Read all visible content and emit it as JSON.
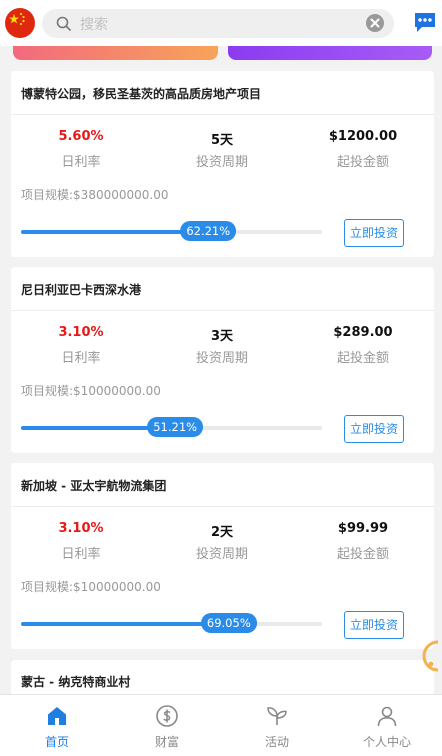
{
  "header": {
    "search_placeholder": "搜索"
  },
  "projects": [
    {
      "title": "博蒙特公园，移民圣基茨的高品质房地产项目",
      "rate": "5.60%",
      "rate_label": "日利率",
      "period": "5天",
      "period_label": "投资周期",
      "min": "$1200.00",
      "min_label": "起投金额",
      "scale": "项目规模:$380000000.00",
      "progress_text": "62.21%",
      "progress": 0.6221,
      "button": "立即投资"
    },
    {
      "title": "尼日利亚巴卡西深水港",
      "rate": "3.10%",
      "rate_label": "日利率",
      "period": "3天",
      "period_label": "投资周期",
      "min": "$289.00",
      "min_label": "起投金额",
      "scale": "项目规模:$10000000.00",
      "progress_text": "51.21%",
      "progress": 0.5121,
      "button": "立即投资"
    },
    {
      "title": "新加坡 - 亚太宇航物流集团",
      "rate": "3.10%",
      "rate_label": "日利率",
      "period": "2天",
      "period_label": "投资周期",
      "min": "$99.99",
      "min_label": "起投金额",
      "scale": "项目规模:$10000000.00",
      "progress_text": "69.05%",
      "progress": 0.6905,
      "button": "立即投资"
    }
  ],
  "partial_card_title": "蒙古 - 纳克特商业村",
  "tabs": [
    {
      "label": "首页",
      "icon": "home-icon",
      "active": true
    },
    {
      "label": "财富",
      "icon": "dollar-coin-icon",
      "active": false
    },
    {
      "label": "活动",
      "icon": "sprout-icon",
      "active": false
    },
    {
      "label": "个人中心",
      "icon": "user-icon",
      "active": false
    }
  ],
  "colors": {
    "accent": "#2a8ce8",
    "rate": "#e81818",
    "active_tab": "#1e7fe0"
  }
}
